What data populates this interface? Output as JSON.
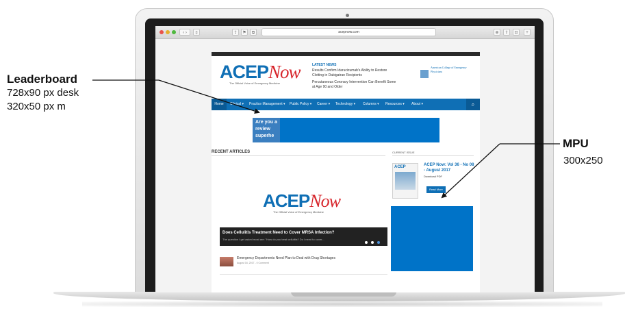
{
  "annotations": {
    "leaderboard": {
      "title": "Leaderboard",
      "line1_size": "728x90 px",
      "line1_device": "desk",
      "line2_size": "320x50 px",
      "line2_device": "m"
    },
    "mpu": {
      "title": "MPU",
      "size": "300x250"
    }
  },
  "browser": {
    "url": "acepnow.com"
  },
  "site": {
    "logo_main": "ACEP",
    "logo_now": "Now",
    "tagline": "The Official Voice of Emergency Medicine",
    "latest_news_label": "LATEST NEWS",
    "news": [
      "Results Confirm Idarucizumab's Ability to Restore Clotting in Dabigatran Recipients",
      "Percutaneous Coronary Intervention Can Benefit Some at Age 90 and Older"
    ],
    "acep_org": "American College of Emergency Physicians",
    "nav": [
      "Home",
      "Clinical ▾",
      "Practice Management ▾",
      "Public Policy ▾",
      "Career ▾",
      "Technology ▾",
      "Columns ▾",
      "Resources ▾",
      "About ▾"
    ],
    "leaderboard_ad_text": "Are you a review superhe",
    "recent_articles_label": "RECENT ARTICLES",
    "current_issue_label": "CURRENT ISSUE",
    "featured_title": "Does Cellulitis Treatment Need to Cover MRSA Infection?",
    "featured_excerpt": "The question I get asked most are: \"How do you treat cellulitis? Do I need to cover...",
    "article2_title": "Emergency Departments Need Plan to Deal with Drug Shortages",
    "article2_meta": "August 16, 2017 - 0 Comment",
    "issue_title": "ACEP Now: Vol 36 - No 08 - August 2017",
    "download_pdf": "Download PDF",
    "read_more": "Read More"
  },
  "colors": {
    "brand_blue": "#0f6fb5",
    "ad_blue": "#0073c8",
    "logo_red": "#d7262c"
  }
}
